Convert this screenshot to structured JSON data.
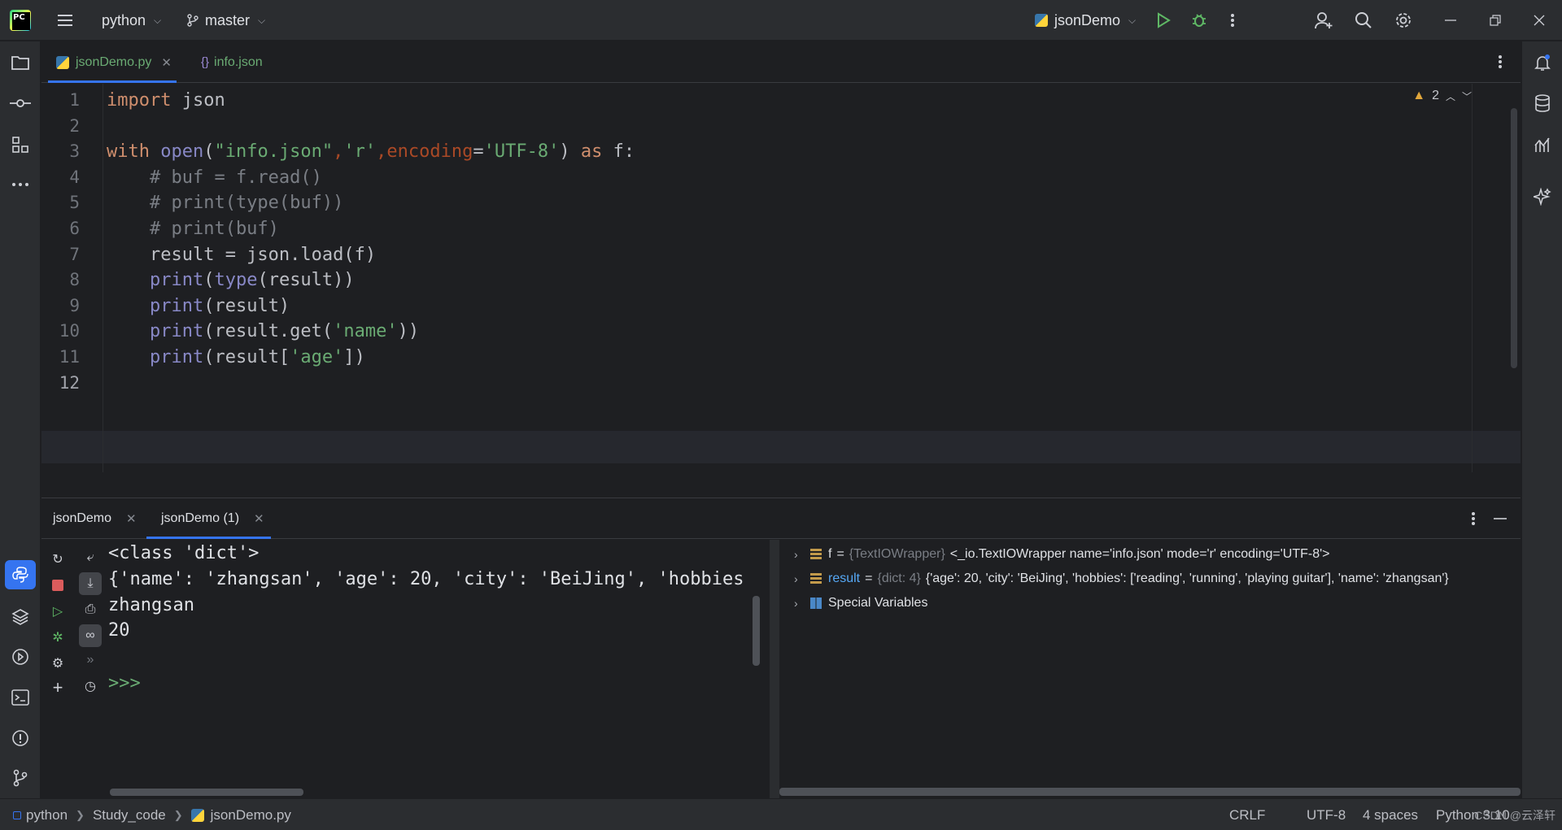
{
  "titlebar": {
    "project": "python",
    "branch": "master",
    "run_config": "jsonDemo"
  },
  "editor_tabs": [
    {
      "label": "jsonDemo.py",
      "icon": "python-file-icon",
      "active": true,
      "closable": true
    },
    {
      "label": "info.json",
      "icon": "json-file-icon",
      "active": false,
      "closable": false
    }
  ],
  "editor": {
    "warnings_count": "2",
    "line_numbers": [
      "1",
      "2",
      "3",
      "4",
      "5",
      "6",
      "7",
      "8",
      "9",
      "10",
      "11",
      "12"
    ],
    "current_line": 12
  },
  "bottom_panel": {
    "tabs": [
      {
        "label": "jsonDemo",
        "active": false
      },
      {
        "label": "jsonDemo (1)",
        "active": true
      }
    ],
    "console_lines": [
      "<class 'dict'>",
      "{'name': 'zhangsan', 'age': 20, 'city': 'BeiJing', 'hobbies",
      "zhangsan",
      "20",
      ""
    ],
    "prompt": ">>>",
    "variables": [
      {
        "name": "f",
        "type": "{TextIOWrapper}",
        "value": "<_io.TextIOWrapper name='info.json' mode='r' encoding='UTF-8'>"
      },
      {
        "name": "result",
        "type": "{dict: 4}",
        "value": "{'age': 20, 'city': 'BeiJing', 'hobbies': ['reading', 'running', 'playing guitar'], 'name': 'zhangsan'}"
      },
      {
        "name": "Special Variables",
        "type": "",
        "value": ""
      }
    ]
  },
  "statusbar": {
    "breadcrumbs": [
      "python",
      "Study_code",
      "jsonDemo.py"
    ],
    "line_ending": "CRLF",
    "encoding": "UTF-8",
    "indent": "4 spaces",
    "interpreter": "Python 3.10",
    "watermark": "CSDN @云泽轩"
  },
  "colors": {
    "accent": "#3574f0",
    "keyword": "#cf8e6d",
    "string": "#6aab73",
    "function": "#56a8f5",
    "comment": "#7a7e85"
  }
}
